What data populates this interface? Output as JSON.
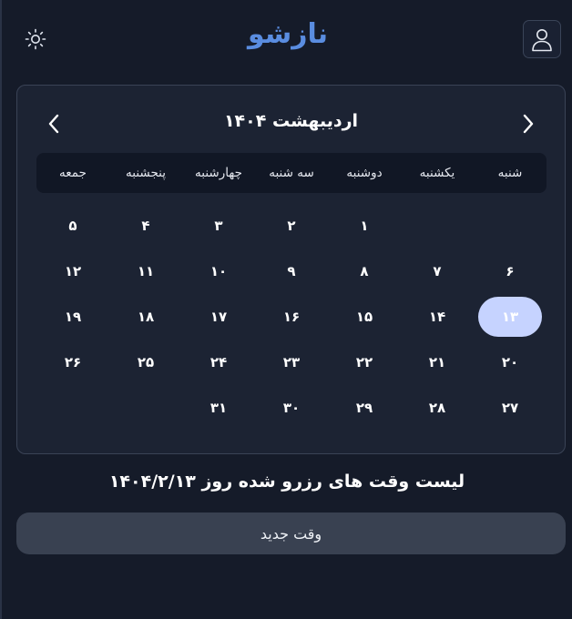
{
  "header": {
    "logo_text": "نازشو",
    "theme_icon": "sun-icon",
    "profile_icon": "user-icon"
  },
  "calendar": {
    "month_title": "اردیبهشت ۱۴۰۴",
    "prev_icon": "chevron-left-icon",
    "next_icon": "chevron-right-icon",
    "weekdays": [
      "شنبه",
      "یکشنبه",
      "دوشنبه",
      "سه شنبه",
      "چهارشنبه",
      "پنجشنبه",
      "جمعه"
    ],
    "days": [
      "",
      "",
      "۱",
      "۲",
      "۳",
      "۴",
      "۵",
      "۶",
      "۷",
      "۸",
      "۹",
      "۱۰",
      "۱۱",
      "۱۲",
      "۱۳",
      "۱۴",
      "۱۵",
      "۱۶",
      "۱۷",
      "۱۸",
      "۱۹",
      "۲۰",
      "۲۱",
      "۲۲",
      "۲۳",
      "۲۴",
      "۲۵",
      "۲۶",
      "۲۷",
      "۲۸",
      "۲۹",
      "۳۰",
      "۳۱",
      "",
      ""
    ],
    "selected_day": "۱۳"
  },
  "reservations": {
    "title": "لیست وقت های رزرو شده روز ۱۴۰۴/۲/۱۳",
    "new_button_label": "وقت جدید"
  },
  "colors": {
    "background": "#151b29",
    "card": "#1c2333",
    "logo": "#5a8de0",
    "selected_day_bg": "#c6d3ff",
    "button": "#394151"
  }
}
